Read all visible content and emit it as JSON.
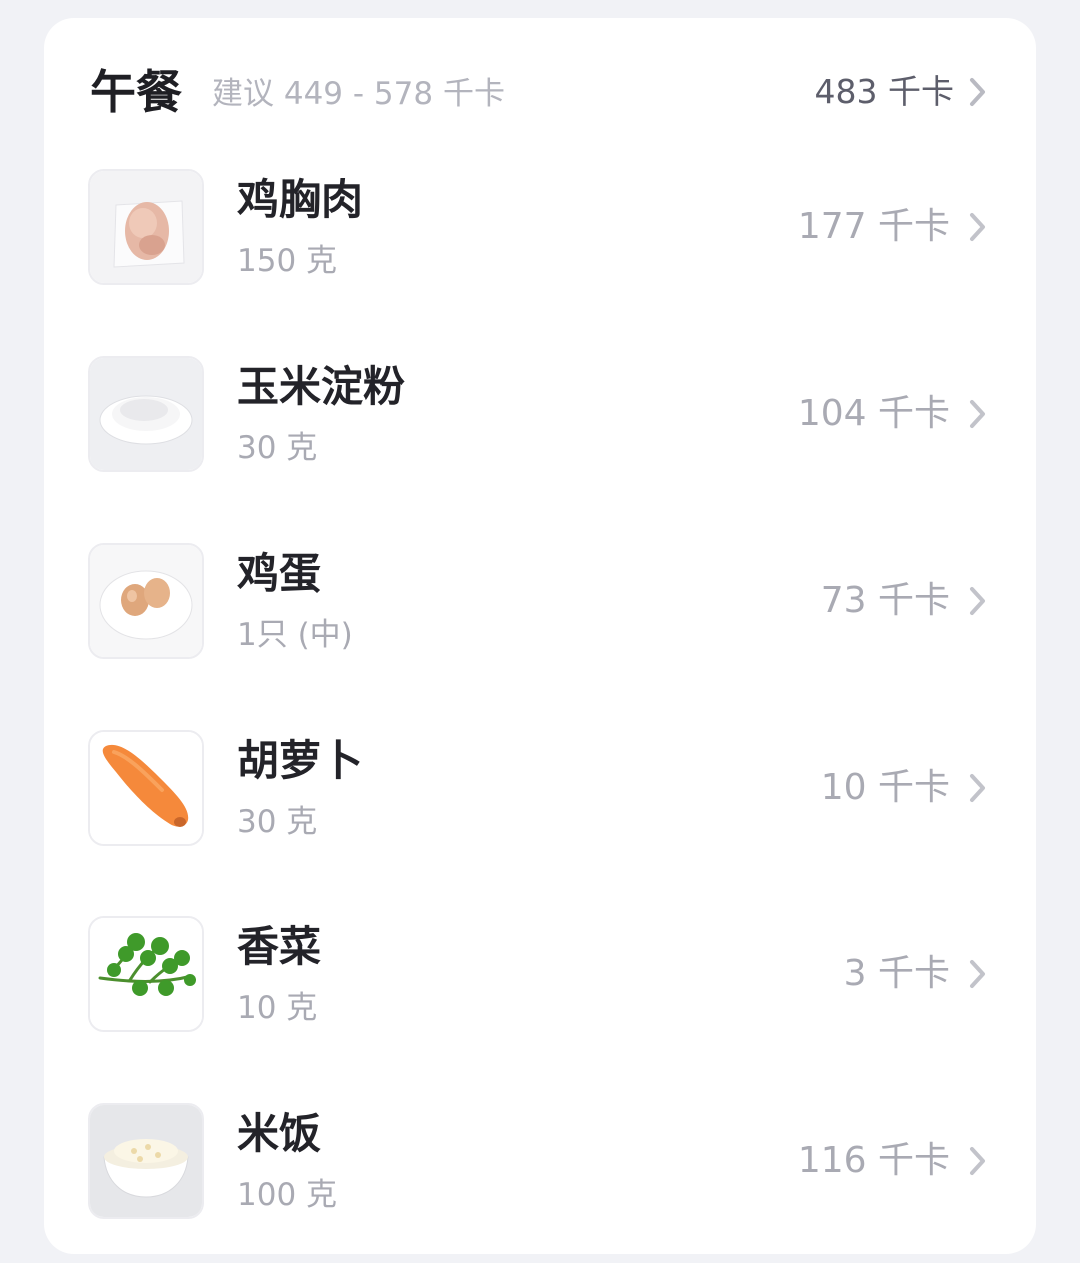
{
  "meal": {
    "title": "午餐",
    "suggestion": "建议 449 - 578 千卡",
    "total": "483 千卡",
    "chevron_icon": "chevron-right-icon"
  },
  "foods": [
    {
      "name": "鸡胸肉",
      "amount": "150 克",
      "kcal": "177 千卡",
      "image": "chicken-breast-photo"
    },
    {
      "name": "玉米淀粉",
      "amount": "30 克",
      "kcal": "104 千卡",
      "image": "corn-starch-photo"
    },
    {
      "name": "鸡蛋",
      "amount": "1只 (中)",
      "kcal": "73 千卡",
      "image": "eggs-photo"
    },
    {
      "name": "胡萝卜",
      "amount": "30 克",
      "kcal": "10 千卡",
      "image": "carrot-photo"
    },
    {
      "name": "香菜",
      "amount": "10 克",
      "kcal": "3 千卡",
      "image": "coriander-photo"
    },
    {
      "name": "米饭",
      "amount": "100 克",
      "kcal": "116 千卡",
      "image": "rice-photo"
    }
  ]
}
